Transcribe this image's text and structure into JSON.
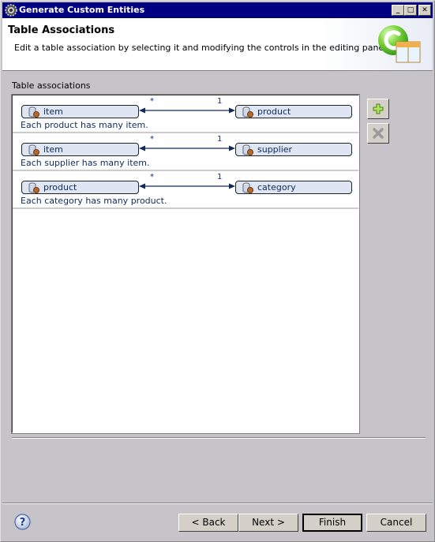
{
  "window": {
    "title": "Generate Custom Entities",
    "controls": [
      "minimize",
      "maximize",
      "close"
    ]
  },
  "header": {
    "title": "Table Associations",
    "description": "Edit a table association by selecting it and modifying the controls in the editing panel."
  },
  "associations_label": "Table associations",
  "associations": [
    {
      "left_table": "item",
      "right_table": "product",
      "left_multiplicity": "*",
      "right_multiplicity": "1",
      "description": "Each product has many item."
    },
    {
      "left_table": "item",
      "right_table": "supplier",
      "left_multiplicity": "*",
      "right_multiplicity": "1",
      "description": "Each supplier has many item."
    },
    {
      "left_table": "product",
      "right_table": "category",
      "left_multiplicity": "*",
      "right_multiplicity": "1",
      "description": "Each category has many product."
    }
  ],
  "side_buttons": {
    "add": {
      "icon": "plus-icon",
      "enabled": true
    },
    "remove": {
      "icon": "x-icon",
      "enabled": false
    }
  },
  "footer": {
    "help_icon": "help-icon",
    "back": "< Back",
    "next": "Next >",
    "finish": "Finish",
    "cancel": "Cancel"
  }
}
